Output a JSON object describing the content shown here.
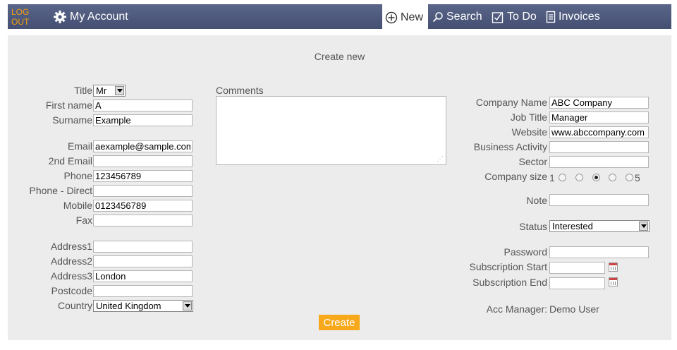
{
  "nav": {
    "logout_line1": "LOG",
    "logout_line2": "OUT",
    "my_account": "My Account",
    "new": "New",
    "search": "Search",
    "todo": "To Do",
    "invoices": "Invoices",
    "icons": {
      "my_account": "gear-icon",
      "new": "plus-circle-icon",
      "search": "magnifier-icon",
      "todo": "checkbox-icon",
      "invoices": "document-icon"
    },
    "logout_color": "#f39c12",
    "bar_color": "#4e5a7e"
  },
  "page": {
    "title": "Create new"
  },
  "personal": {
    "title_label": "Title",
    "title_value": "Mr",
    "first_name_label": "First name",
    "first_name_value": "A",
    "surname_label": "Surname",
    "surname_value": "Example",
    "email_label": "Email",
    "email_value": "aexample@sample.com",
    "email2_label": "2nd Email",
    "email2_value": "",
    "phone_label": "Phone",
    "phone_value": "123456789",
    "phone_direct_label": "Phone - Direct",
    "phone_direct_value": "",
    "mobile_label": "Mobile",
    "mobile_value": "0123456789",
    "fax_label": "Fax",
    "fax_value": "",
    "address1_label": "Address1",
    "address1_value": "",
    "address2_label": "Address2",
    "address2_value": "",
    "address3_label": "Address3",
    "address3_value": "London",
    "postcode_label": "Postcode",
    "postcode_value": "",
    "country_label": "Country",
    "country_value": "United Kingdom"
  },
  "comments": {
    "label": "Comments",
    "value": ""
  },
  "company": {
    "name_label": "Company Name",
    "name_value": "ABC Company",
    "job_title_label": "Job Title",
    "job_title_value": "Manager",
    "website_label": "Website",
    "website_value": "www.abccompany.com",
    "activity_label": "Business Activity",
    "activity_value": "",
    "sector_label": "Sector",
    "sector_value": "",
    "size_label": "Company size",
    "size_min": "1",
    "size_max": "5",
    "size_selected": 3,
    "note_label": "Note",
    "note_value": "",
    "status_label": "Status",
    "status_value": "Interested",
    "password_label": "Password",
    "password_value": "",
    "sub_start_label": "Subscription Start",
    "sub_start_value": "",
    "sub_end_label": "Subscription End",
    "sub_end_value": "",
    "acc_manager_label": "Acc Manager:",
    "acc_manager_value": "Demo User"
  },
  "actions": {
    "create": "Create",
    "create_color": "#f7a81b"
  }
}
